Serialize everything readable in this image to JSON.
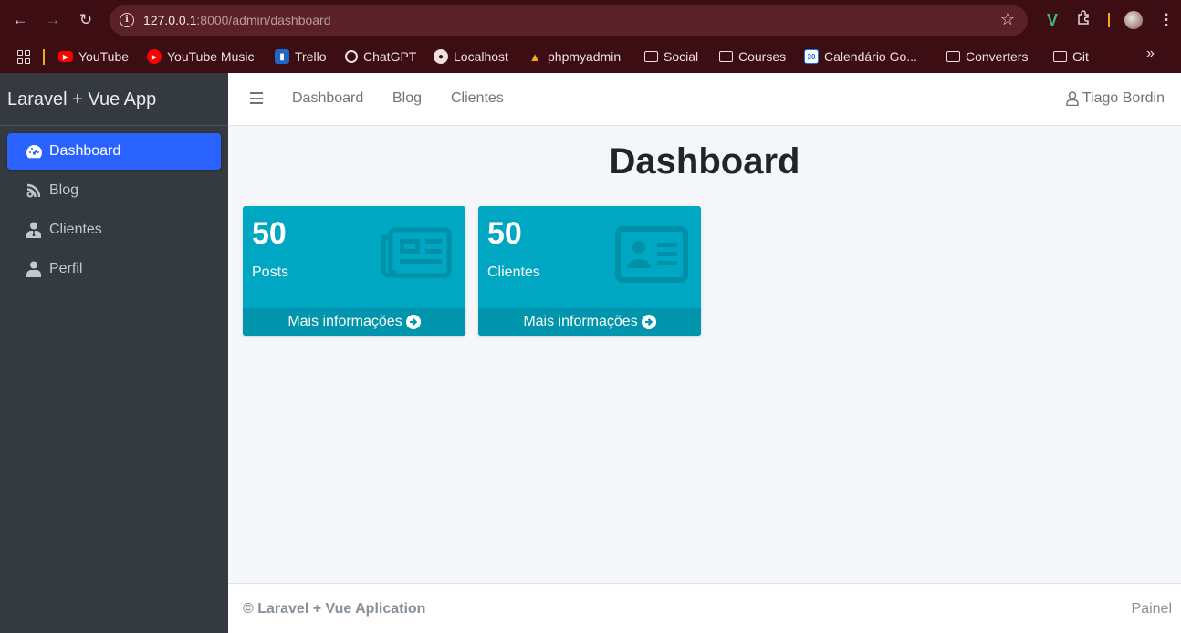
{
  "browser": {
    "url_host": "127.0.0.1",
    "url_path": ":8000/admin/dashboard",
    "bookmarks": [
      {
        "label": "YouTube",
        "icon": "youtube-icon"
      },
      {
        "label": "YouTube Music",
        "icon": "youtube-music-icon"
      },
      {
        "label": "Trello",
        "icon": "trello-icon"
      },
      {
        "label": "ChatGPT",
        "icon": "chatgpt-icon"
      },
      {
        "label": "Localhost",
        "icon": "globe-icon"
      },
      {
        "label": "phpmyadmin",
        "icon": "phpmyadmin-icon"
      },
      {
        "label": "Social",
        "icon": "folder-icon"
      },
      {
        "label": "Courses",
        "icon": "folder-icon"
      },
      {
        "label": "Calendário Go...",
        "icon": "calendar-icon"
      },
      {
        "label": "Converters",
        "icon": "folder-icon"
      },
      {
        "label": "Git",
        "icon": "folder-icon"
      }
    ],
    "calendar_day": "30",
    "more_bookmarks": "»"
  },
  "sidebar": {
    "brand": "Laravel + Vue App",
    "items": [
      {
        "label": "Dashboard",
        "icon": "tachometer-icon",
        "active": true
      },
      {
        "label": "Blog",
        "icon": "blog-icon",
        "active": false
      },
      {
        "label": "Clientes",
        "icon": "user-tie-icon",
        "active": false
      },
      {
        "label": "Perfil",
        "icon": "user-icon",
        "active": false
      }
    ]
  },
  "navbar": {
    "links": [
      "Dashboard",
      "Blog",
      "Clientes"
    ],
    "user": "Tiago Bordin"
  },
  "main": {
    "title": "Dashboard",
    "boxes": [
      {
        "value": "50",
        "label": "Posts",
        "footer": "Mais informações",
        "icon": "newspaper-icon"
      },
      {
        "value": "50",
        "label": "Clientes",
        "footer": "Mais informações",
        "icon": "id-card-icon"
      }
    ]
  },
  "footer": {
    "left": "© Laravel + Vue Aplication",
    "right": "Painel"
  },
  "colors": {
    "browser_bg": "#3c0d12",
    "sidebar_bg": "#343a40",
    "active_item": "#2962ff",
    "info_box": "#00a7c3"
  }
}
